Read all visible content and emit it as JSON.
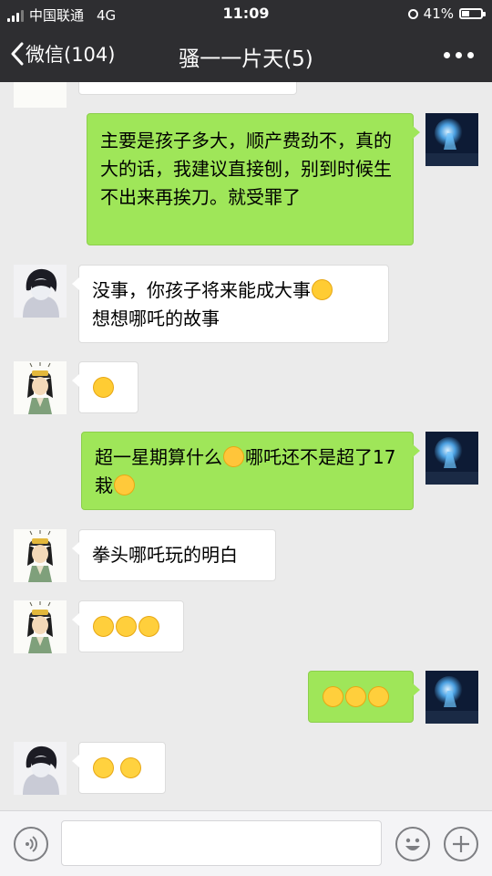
{
  "status_bar": {
    "carrier": "中国联通",
    "network": "4G",
    "time": "11:09",
    "battery": "41%",
    "battery_level": 0.41
  },
  "nav": {
    "back_label": "微信(104)",
    "title": "骚一一片天(5)"
  },
  "messages": [
    {
      "side": "out",
      "text": "主要是孩子多大，顺产费劲不，真的大的话，我建议直接刨，别到时候生不出来再挨刀。就受罪了"
    },
    {
      "side": "in",
      "text": "没事，你孩子将来能成大事",
      "emoji": [
        "flushed-face"
      ],
      "text2": "想想哪吒的故事"
    },
    {
      "side": "in",
      "emoji": [
        "flushed-face"
      ]
    },
    {
      "side": "out",
      "text": "超一星期算什么",
      "emoji": [
        "angry-face"
      ],
      "text2": "哪吒还不是超了17栽",
      "emoji2": [
        "blushing-face"
      ]
    },
    {
      "side": "in",
      "text": "拳头哪吒玩的明白"
    },
    {
      "side": "in",
      "emoji": [
        "thinking-face",
        "thinking-face",
        "thinking-face"
      ]
    },
    {
      "side": "out",
      "emoji": [
        "thinking-face",
        "thinking-face",
        "thinking-face"
      ]
    },
    {
      "side": "in",
      "emoji": [
        "tears-of-joy-face",
        "tears-of-joy-face"
      ]
    }
  ],
  "colors": {
    "bar_bg": "#2e2e31",
    "chat_bg": "#ebebeb",
    "out_bubble": "#9fe659",
    "in_bubble": "#ffffff"
  },
  "input_bar": {
    "voice_icon": "voice-icon",
    "emoji_icon": "smiley-icon",
    "add_icon": "plus-icon",
    "text": ""
  }
}
